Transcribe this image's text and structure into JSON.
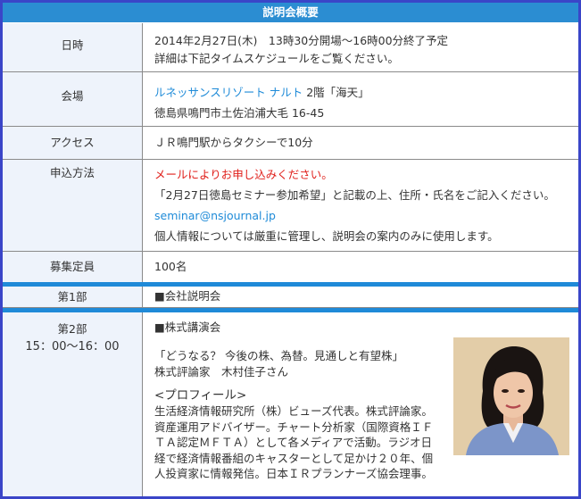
{
  "header": {
    "title": "説明会概要"
  },
  "rows": {
    "datetime": {
      "label": "日時",
      "line1": "2014年2月27日(木)　13時30分開場～16時00分終了予定",
      "line2": "詳細は下記タイムスケジュールをご覧ください。"
    },
    "venue": {
      "label": "会場",
      "name_link": "ルネッサンスリゾート ナルト",
      "name_rest": " 2階「海天」",
      "address": "徳島県鳴門市土佐泊浦大毛 16-45"
    },
    "access": {
      "label": "アクセス",
      "text": "ＪＲ鳴門駅からタクシーで10分"
    },
    "apply": {
      "label": "申込方法",
      "line1": "メールによりお申し込みください。",
      "line2": "「2月27日徳島セミナー参加希望」と記載の上、住所・氏名をご記入ください。",
      "email": "seminar@nsjournal.jp",
      "line4": "個人情報については厳重に管理し、説明会の案内のみに使用します。"
    },
    "capacity": {
      "label": "募集定員",
      "text": "100名"
    },
    "part1": {
      "label": "第1部",
      "text": "■会社説明会"
    },
    "part2": {
      "label": "第2部",
      "time": "15：00～16：00",
      "heading": "■株式講演会",
      "title": "「どうなる？ 今後の株、為替。見通しと有望株」",
      "speaker": "株式評論家　木村佳子さん",
      "profile_head": "<プロフィール>",
      "profile_lines": [
        "生活経済情報研究所（株）ビューズ代表。株式評論家。",
        "資産運用アドバイザー。チャート分析家（国際資格ＩＦ",
        "ＴＡ認定ＭＦＴＡ）として各メディアで活動。ラジオ日",
        "経で経済情報番組のキャスターとして足かけ２０年、個",
        "人投資家に情報発信。日本ＩＲプランナーズ協会理事。"
      ]
    }
  },
  "colors": {
    "header_bg": "#2b8dd2",
    "label_bg": "#eef3fb",
    "link": "#1f8bd8",
    "alert": "#e0201b",
    "frame": "#3a45c8"
  },
  "icons": {
    "speaker_photo": "speaker-portrait-photo"
  }
}
